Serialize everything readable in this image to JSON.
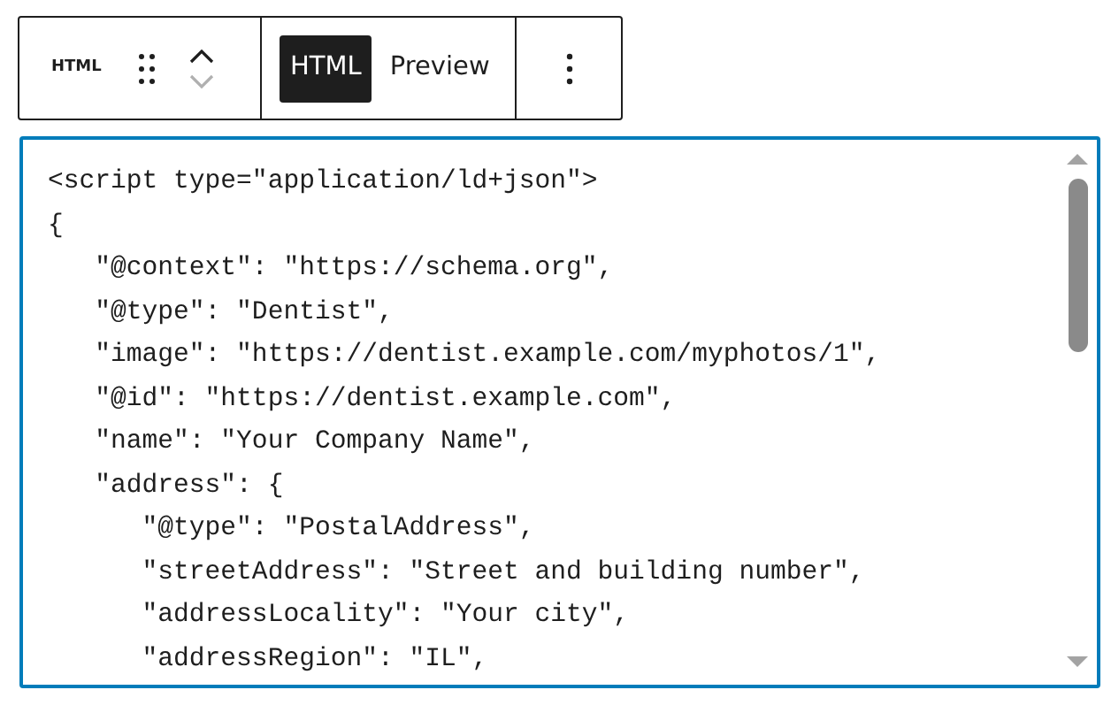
{
  "toolbar": {
    "block_label": "HTML",
    "movers": [
      {
        "kind": "up",
        "disabled": false
      },
      {
        "kind": "down",
        "disabled": true
      }
    ],
    "tabs": [
      {
        "label": "HTML",
        "selected": true
      },
      {
        "label": "Preview",
        "selected": false
      }
    ]
  },
  "editor": {
    "lines": [
      "<script type=\"application/ld+json\">",
      "{",
      "   \"@context\": \"https://schema.org\",",
      "   \"@type\": \"Dentist\",",
      "   \"image\": \"https://dentist.example.com/myphotos/1\",",
      "   \"@id\": \"https://dentist.example.com\",",
      "   \"name\": \"Your Company Name\",",
      "   \"address\": {",
      "      \"@type\": \"PostalAddress\",",
      "      \"streetAddress\": \"Street and building number\",",
      "      \"addressLocality\": \"Your city\",",
      "      \"addressRegion\": \"IL\","
    ]
  }
}
